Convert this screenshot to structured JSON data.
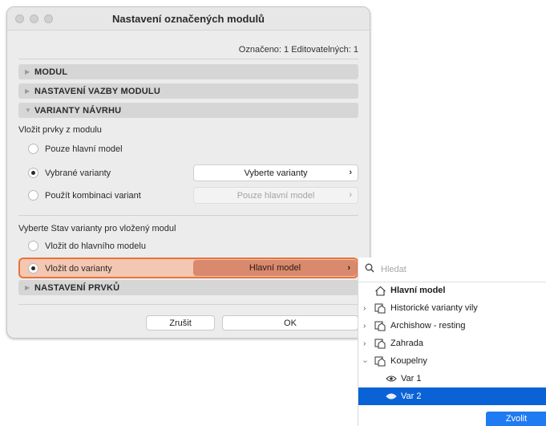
{
  "window": {
    "title": "Nastavení označených modulů",
    "selection_info": "Označeno: 1 Editovatelných: 1"
  },
  "sections": {
    "modul": "MODUL",
    "vazba": "NASTAVENÍ VAZBY MODULU",
    "varianty": "VARIANTY NÁVRHU",
    "prvky": "NASTAVENÍ PRVKŮ"
  },
  "insert_from": {
    "label": "Vložit prvky z modulu",
    "options": [
      "Pouze hlavní model",
      "Vybrané varianty",
      "Použít kombinaci variant"
    ],
    "selected": 1,
    "choose_variants_button": "Vyberte varianty",
    "combination_popup": "Pouze hlavní model"
  },
  "insert_state": {
    "label": "Vyberte Stav varianty pro vložený modul",
    "options": [
      "Vložit do hlavního modelu",
      "Vložit do varianty"
    ],
    "selected": 1,
    "variant_popup": "Hlavní model"
  },
  "buttons": {
    "cancel": "Zrušit",
    "ok": "OK"
  },
  "dropdown": {
    "search_placeholder": "Hledat",
    "items": [
      {
        "label": "Hlavní model",
        "icon": "house-icon",
        "bold": true
      },
      {
        "label": "Historické varianty vily",
        "icon": "variant-set-icon",
        "expandable": true
      },
      {
        "label": "Archishow - resting",
        "icon": "variant-set-icon",
        "expandable": true
      },
      {
        "label": "Zahrada",
        "icon": "variant-set-icon",
        "expandable": true
      },
      {
        "label": "Koupelny",
        "icon": "variant-set-icon",
        "expanded": true
      },
      {
        "label": "Var 1",
        "icon": "eye-icon"
      },
      {
        "label": "Var 2",
        "icon": "eye-icon",
        "selected": true
      }
    ],
    "choose_button": "Zvolit"
  },
  "colors": {
    "accent": "#0a63d6",
    "highlight_border": "#e8733a",
    "highlight_fill": "#f4c7b2"
  }
}
